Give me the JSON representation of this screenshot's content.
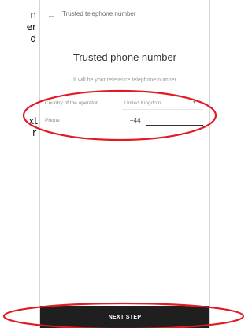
{
  "side_text": [
    "n",
    "er",
    "d",
    "xt",
    "r"
  ],
  "app_bar": {
    "back_icon": "back-arrow-icon",
    "title": "Trusted telephone number"
  },
  "main": {
    "heading": "Trusted phone number",
    "subtitle": "It will be your reference telephone number"
  },
  "form": {
    "country_label": "Country of the operator",
    "country_value": "United Kingdom",
    "country_caret_icon": "caret-down-icon",
    "phone_label": "Phone",
    "phone_prefix": "+44",
    "phone_value": ""
  },
  "footer": {
    "next_label": "NEXT STEP"
  },
  "colors": {
    "annotation": "#e01b24",
    "button_bg": "#1f1f1f"
  }
}
